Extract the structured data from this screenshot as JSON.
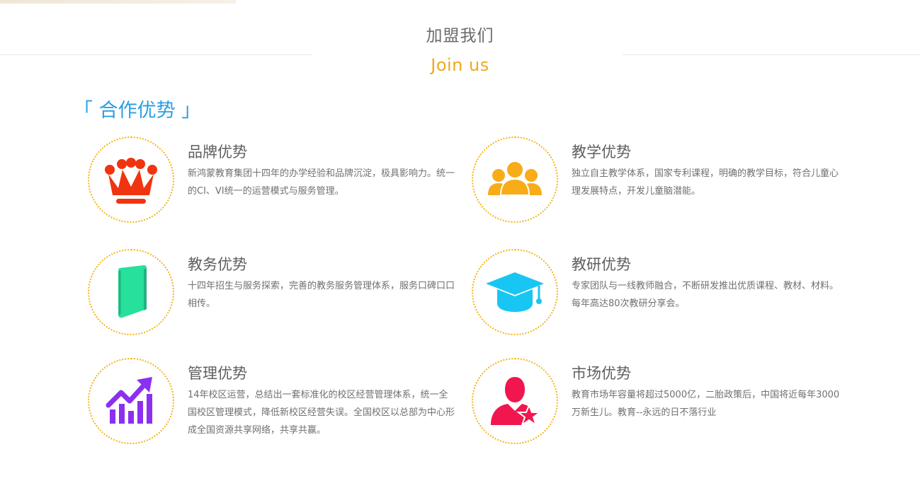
{
  "header": {
    "title": "加盟我们",
    "subtitle": "Join us"
  },
  "cooperation": {
    "open_bracket": "「",
    "heading": "合作优势",
    "close_bracket": "」"
  },
  "items": [
    {
      "icon": "crown-icon",
      "color": "#f0340f",
      "title": "品牌优势",
      "desc": "新鸿蒙教育集团十四年的办学经验和品牌沉淀，极具影响力。统一的CI、VI统一的运营模式与服务管理。"
    },
    {
      "icon": "team-icon",
      "color": "#f7ac18",
      "title": "教学优势",
      "desc": "独立自主教学体系，国家专利课程，明确的教学目标，符合儿童心理发展特点，开发儿童脑潜能。"
    },
    {
      "icon": "book-icon",
      "color": "#26e09c",
      "title": "教务优势",
      "desc": "十四年招生与服务探索，完善的教务服务管理体系，服务口碑口口相传。"
    },
    {
      "icon": "graduation-cap-icon",
      "color": "#18c6f3",
      "title": "教研优势",
      "desc": "专家团队与一线教师融合，不断研发推出优质课程、教材、材料。每年高达80次教研分享会。"
    },
    {
      "icon": "growth-chart-icon",
      "color": "#8b2ff0",
      "title": "管理优势",
      "desc": "14年校区运营，总结出一套标准化的校区经营管理体系，统一全国校区管理模式，降低新校区经营失误。全国校区以总部为中心形成全国资源共享网络，共享共赢。"
    },
    {
      "icon": "user-star-icon",
      "color": "#f2164e",
      "title": "市场优势",
      "desc": "教育市场年容量将超过5000亿，二胎政策后，中国将近每年3000万新生儿。教育--永远的日不落行业"
    }
  ]
}
